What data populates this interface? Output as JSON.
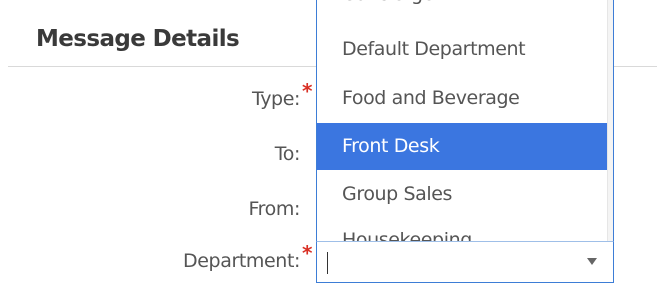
{
  "section": {
    "title": "Message Details"
  },
  "form": {
    "type_label": "Type:",
    "to_label": "To:",
    "from_label": "From:",
    "department_label": "Department:",
    "required_mark": "*"
  },
  "department_dropdown": {
    "current_value": "",
    "options": [
      "Concierge",
      "Default Department",
      "Food and Beverage",
      "Front Desk",
      "Group Sales",
      "Housekeeping"
    ],
    "highlighted_option": "Front Desk",
    "icon": "chevron-down-icon"
  },
  "colors": {
    "highlight": "#3b76e0",
    "focus_border": "#3d7dd6",
    "required": "#d93025"
  }
}
